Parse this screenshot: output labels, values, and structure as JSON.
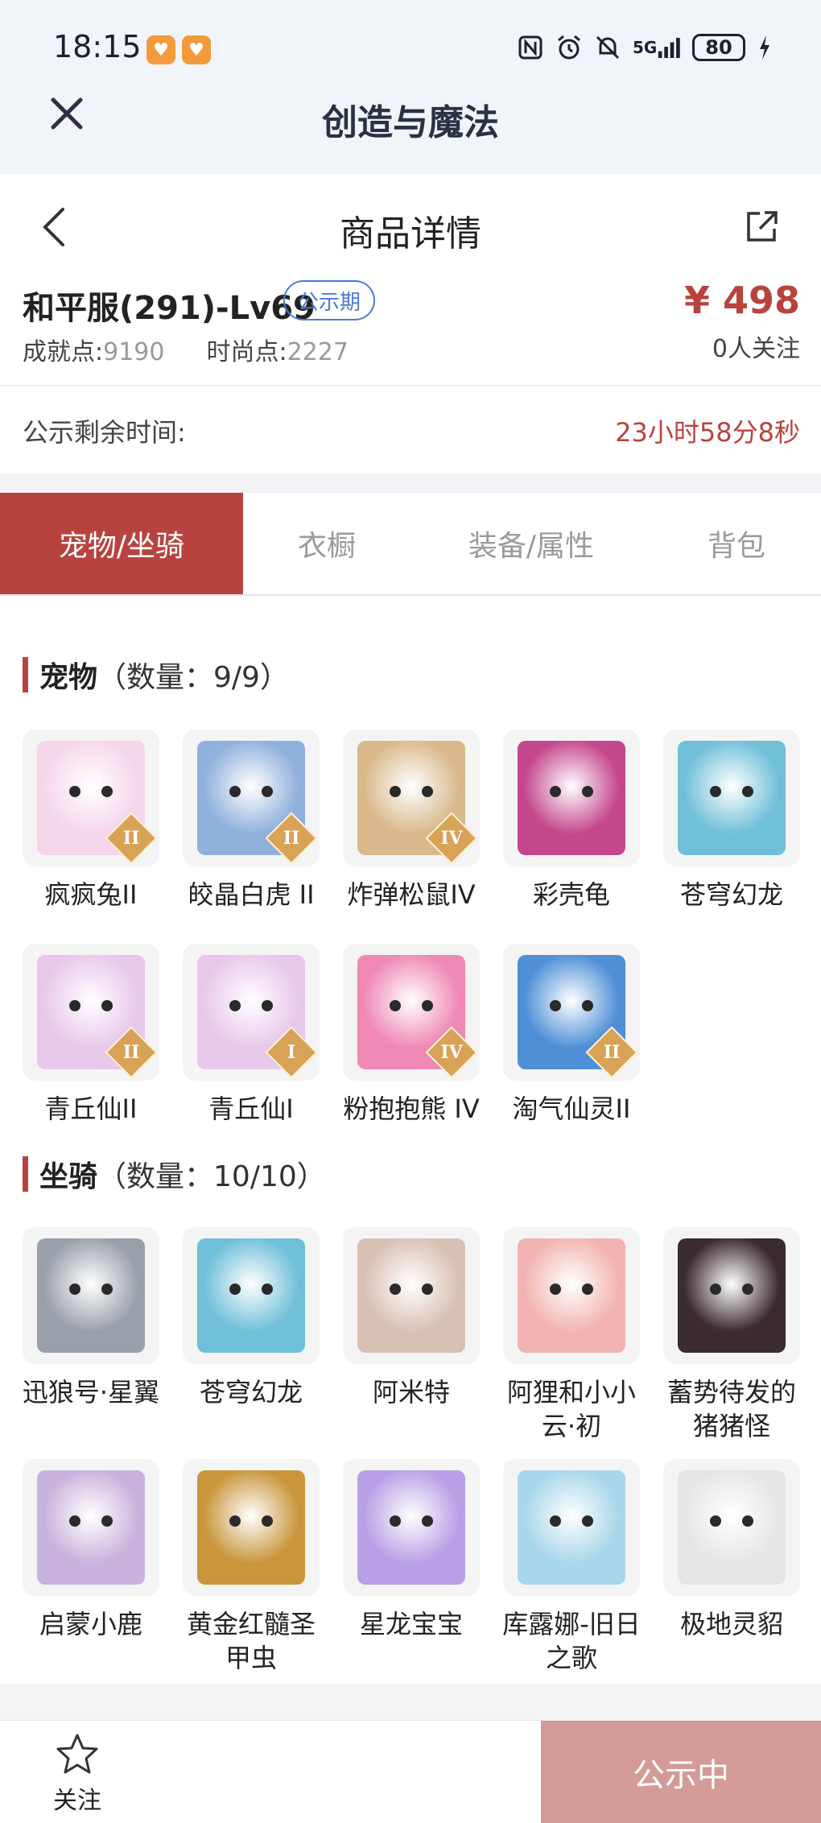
{
  "status_bar": {
    "time": "18:15",
    "network": "5G",
    "battery": "80"
  },
  "app": {
    "title": "创造与魔法"
  },
  "header": {
    "title": "商品详情"
  },
  "product": {
    "name": "和平服(291)-Lv69",
    "badge": "公示期",
    "achievement_label": "成就点:",
    "achievement_value": "9190",
    "fashion_label": "时尚点:",
    "fashion_value": "2227",
    "price": "¥ 498",
    "followers": "0人关注"
  },
  "timer": {
    "label": "公示剩余时间:",
    "value": "23小时58分8秒"
  },
  "tabs": [
    "宠物/坐骑",
    "衣橱",
    "装备/属性",
    "背包"
  ],
  "pets": {
    "title": "宠物",
    "count": "（数量：9/9）",
    "items": [
      {
        "name": "疯疯兔II",
        "tier": "II",
        "color": "#f6d6ea"
      },
      {
        "name": "皎晶白虎 II",
        "tier": "II",
        "color": "#8fb0dc"
      },
      {
        "name": "炸弹松鼠IV",
        "tier": "IV",
        "color": "#d9b98c"
      },
      {
        "name": "彩壳龟",
        "tier": "",
        "color": "#c4468c"
      },
      {
        "name": "苍穹幻龙",
        "tier": "",
        "color": "#6fbfd9"
      },
      {
        "name": "青丘仙II",
        "tier": "II",
        "color": "#e8c8ea"
      },
      {
        "name": "青丘仙I",
        "tier": "I",
        "color": "#e8c8ea"
      },
      {
        "name": "粉抱抱熊 IV",
        "tier": "IV",
        "color": "#f088b4"
      },
      {
        "name": "淘气仙灵II",
        "tier": "II",
        "color": "#4e8fd6"
      }
    ]
  },
  "mounts": {
    "title": "坐骑",
    "count": "（数量：10/10）",
    "items": [
      {
        "name": "迅狼号·星翼",
        "color": "#9aa0aa"
      },
      {
        "name": "苍穹幻龙",
        "color": "#6fbfd9"
      },
      {
        "name": "阿米特",
        "color": "#d9c0b4"
      },
      {
        "name": "阿狸和小小云·初",
        "color": "#f2b4b0"
      },
      {
        "name": "蓄势待发的猪猪怪",
        "color": "#3b2a2e"
      },
      {
        "name": "启蒙小鹿",
        "color": "#c9b2dc"
      },
      {
        "name": "黄金红髓圣甲虫",
        "color": "#c9963c"
      },
      {
        "name": "星龙宝宝",
        "color": "#b8a0e6"
      },
      {
        "name": "库露娜-旧日之歌",
        "color": "#a8d6ea"
      },
      {
        "name": "极地灵貂",
        "color": "#e6e6e6"
      }
    ]
  },
  "bottom": {
    "follow_label": "关注",
    "cta_label": "公示中"
  },
  "colors": {
    "accent": "#b8433e",
    "badge_blue": "#4a7bd8",
    "cta_disabled": "#d49a98"
  }
}
